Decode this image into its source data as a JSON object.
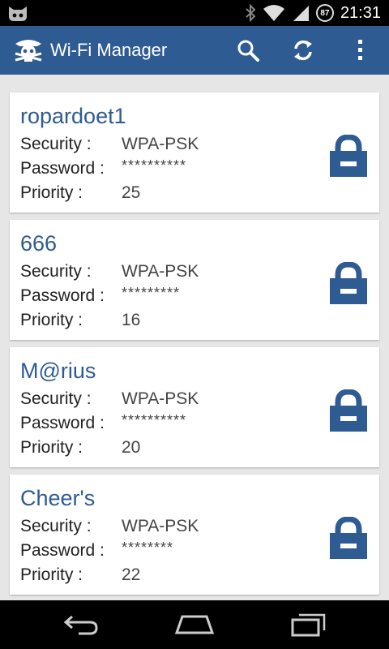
{
  "status_bar": {
    "time": "21:31",
    "battery_level": "87",
    "icons": [
      "cyanogen-android-icon",
      "bluetooth-icon",
      "wifi-icon",
      "signal-icon",
      "battery-icon"
    ]
  },
  "action_bar": {
    "title": "Wi-Fi Manager",
    "icons": [
      "pirate-logo-icon",
      "search-icon",
      "refresh-icon",
      "overflow-menu-icon"
    ],
    "color": "#2e5b91"
  },
  "networks": [
    {
      "ssid": "ropardoet1",
      "security_label": "Security :",
      "security": "WPA-PSK",
      "password_label": "Password :",
      "password": "**********",
      "priority_label": "Priority :",
      "priority": "25"
    },
    {
      "ssid": "666",
      "security_label": "Security :",
      "security": "WPA-PSK",
      "password_label": "Password :",
      "password": "*********",
      "priority_label": "Priority :",
      "priority": "16"
    },
    {
      "ssid": "M@rius",
      "security_label": "Security :",
      "security": "WPA-PSK",
      "password_label": "Password :",
      "password": "**********",
      "priority_label": "Priority :",
      "priority": "20"
    },
    {
      "ssid": "Cheer's",
      "security_label": "Security :",
      "security": "WPA-PSK",
      "password_label": "Password :",
      "password": "********",
      "priority_label": "Priority :",
      "priority": "22"
    }
  ],
  "nav_bar": {
    "icons": [
      "back-icon",
      "home-icon",
      "recent-apps-icon"
    ]
  }
}
